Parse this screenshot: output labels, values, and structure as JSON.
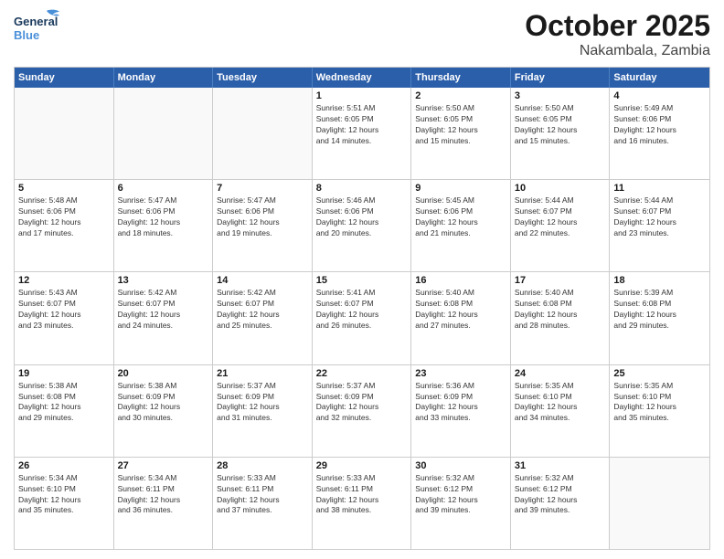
{
  "header": {
    "logo_general": "General",
    "logo_blue": "Blue",
    "month": "October 2025",
    "location": "Nakambala, Zambia"
  },
  "weekdays": [
    "Sunday",
    "Monday",
    "Tuesday",
    "Wednesday",
    "Thursday",
    "Friday",
    "Saturday"
  ],
  "rows": [
    [
      {
        "day": "",
        "info": ""
      },
      {
        "day": "",
        "info": ""
      },
      {
        "day": "",
        "info": ""
      },
      {
        "day": "1",
        "info": "Sunrise: 5:51 AM\nSunset: 6:05 PM\nDaylight: 12 hours\nand 14 minutes."
      },
      {
        "day": "2",
        "info": "Sunrise: 5:50 AM\nSunset: 6:05 PM\nDaylight: 12 hours\nand 15 minutes."
      },
      {
        "day": "3",
        "info": "Sunrise: 5:50 AM\nSunset: 6:05 PM\nDaylight: 12 hours\nand 15 minutes."
      },
      {
        "day": "4",
        "info": "Sunrise: 5:49 AM\nSunset: 6:06 PM\nDaylight: 12 hours\nand 16 minutes."
      }
    ],
    [
      {
        "day": "5",
        "info": "Sunrise: 5:48 AM\nSunset: 6:06 PM\nDaylight: 12 hours\nand 17 minutes."
      },
      {
        "day": "6",
        "info": "Sunrise: 5:47 AM\nSunset: 6:06 PM\nDaylight: 12 hours\nand 18 minutes."
      },
      {
        "day": "7",
        "info": "Sunrise: 5:47 AM\nSunset: 6:06 PM\nDaylight: 12 hours\nand 19 minutes."
      },
      {
        "day": "8",
        "info": "Sunrise: 5:46 AM\nSunset: 6:06 PM\nDaylight: 12 hours\nand 20 minutes."
      },
      {
        "day": "9",
        "info": "Sunrise: 5:45 AM\nSunset: 6:06 PM\nDaylight: 12 hours\nand 21 minutes."
      },
      {
        "day": "10",
        "info": "Sunrise: 5:44 AM\nSunset: 6:07 PM\nDaylight: 12 hours\nand 22 minutes."
      },
      {
        "day": "11",
        "info": "Sunrise: 5:44 AM\nSunset: 6:07 PM\nDaylight: 12 hours\nand 23 minutes."
      }
    ],
    [
      {
        "day": "12",
        "info": "Sunrise: 5:43 AM\nSunset: 6:07 PM\nDaylight: 12 hours\nand 23 minutes."
      },
      {
        "day": "13",
        "info": "Sunrise: 5:42 AM\nSunset: 6:07 PM\nDaylight: 12 hours\nand 24 minutes."
      },
      {
        "day": "14",
        "info": "Sunrise: 5:42 AM\nSunset: 6:07 PM\nDaylight: 12 hours\nand 25 minutes."
      },
      {
        "day": "15",
        "info": "Sunrise: 5:41 AM\nSunset: 6:07 PM\nDaylight: 12 hours\nand 26 minutes."
      },
      {
        "day": "16",
        "info": "Sunrise: 5:40 AM\nSunset: 6:08 PM\nDaylight: 12 hours\nand 27 minutes."
      },
      {
        "day": "17",
        "info": "Sunrise: 5:40 AM\nSunset: 6:08 PM\nDaylight: 12 hours\nand 28 minutes."
      },
      {
        "day": "18",
        "info": "Sunrise: 5:39 AM\nSunset: 6:08 PM\nDaylight: 12 hours\nand 29 minutes."
      }
    ],
    [
      {
        "day": "19",
        "info": "Sunrise: 5:38 AM\nSunset: 6:08 PM\nDaylight: 12 hours\nand 29 minutes."
      },
      {
        "day": "20",
        "info": "Sunrise: 5:38 AM\nSunset: 6:09 PM\nDaylight: 12 hours\nand 30 minutes."
      },
      {
        "day": "21",
        "info": "Sunrise: 5:37 AM\nSunset: 6:09 PM\nDaylight: 12 hours\nand 31 minutes."
      },
      {
        "day": "22",
        "info": "Sunrise: 5:37 AM\nSunset: 6:09 PM\nDaylight: 12 hours\nand 32 minutes."
      },
      {
        "day": "23",
        "info": "Sunrise: 5:36 AM\nSunset: 6:09 PM\nDaylight: 12 hours\nand 33 minutes."
      },
      {
        "day": "24",
        "info": "Sunrise: 5:35 AM\nSunset: 6:10 PM\nDaylight: 12 hours\nand 34 minutes."
      },
      {
        "day": "25",
        "info": "Sunrise: 5:35 AM\nSunset: 6:10 PM\nDaylight: 12 hours\nand 35 minutes."
      }
    ],
    [
      {
        "day": "26",
        "info": "Sunrise: 5:34 AM\nSunset: 6:10 PM\nDaylight: 12 hours\nand 35 minutes."
      },
      {
        "day": "27",
        "info": "Sunrise: 5:34 AM\nSunset: 6:11 PM\nDaylight: 12 hours\nand 36 minutes."
      },
      {
        "day": "28",
        "info": "Sunrise: 5:33 AM\nSunset: 6:11 PM\nDaylight: 12 hours\nand 37 minutes."
      },
      {
        "day": "29",
        "info": "Sunrise: 5:33 AM\nSunset: 6:11 PM\nDaylight: 12 hours\nand 38 minutes."
      },
      {
        "day": "30",
        "info": "Sunrise: 5:32 AM\nSunset: 6:12 PM\nDaylight: 12 hours\nand 39 minutes."
      },
      {
        "day": "31",
        "info": "Sunrise: 5:32 AM\nSunset: 6:12 PM\nDaylight: 12 hours\nand 39 minutes."
      },
      {
        "day": "",
        "info": ""
      }
    ]
  ]
}
